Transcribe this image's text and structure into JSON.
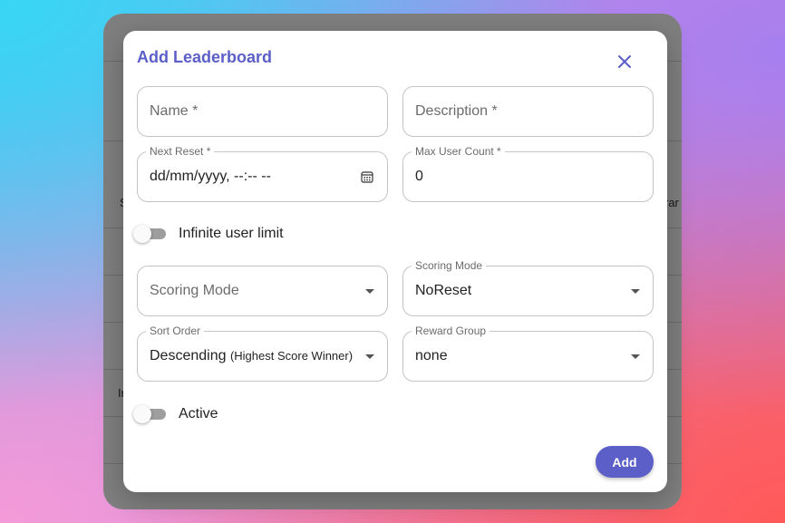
{
  "background_app": {
    "fragments": [
      "S",
      "rar",
      "In"
    ]
  },
  "dialog": {
    "title": "Add Leaderboard",
    "fields": {
      "name": {
        "placeholder": "Name *"
      },
      "description": {
        "placeholder": "Description *"
      },
      "next_reset": {
        "label": "Next Reset *",
        "value": "dd/mm/yyyy, --:-- --"
      },
      "max_user_count": {
        "label": "Max User Count *",
        "value": "0"
      },
      "scoring_mode_left": {
        "placeholder": "Scoring Mode"
      },
      "scoring_mode_right": {
        "label": "Scoring Mode",
        "value": "NoReset"
      },
      "sort_order": {
        "label": "Sort Order",
        "value_main": "Descending",
        "value_sub": "(Highest Score Winner)"
      },
      "reward_group": {
        "label": "Reward Group",
        "value": "none"
      }
    },
    "toggles": {
      "infinite_user_limit": {
        "label": "Infinite user limit",
        "checked": false
      },
      "active": {
        "label": "Active",
        "checked": false
      }
    },
    "add_button_label": "Add"
  },
  "colors": {
    "accent": "#5b5fc7",
    "border": "#c4c4c4"
  },
  "icons": {
    "close": "close-icon",
    "calendar": "calendar-icon",
    "dropdown": "chevron-down-icon"
  }
}
